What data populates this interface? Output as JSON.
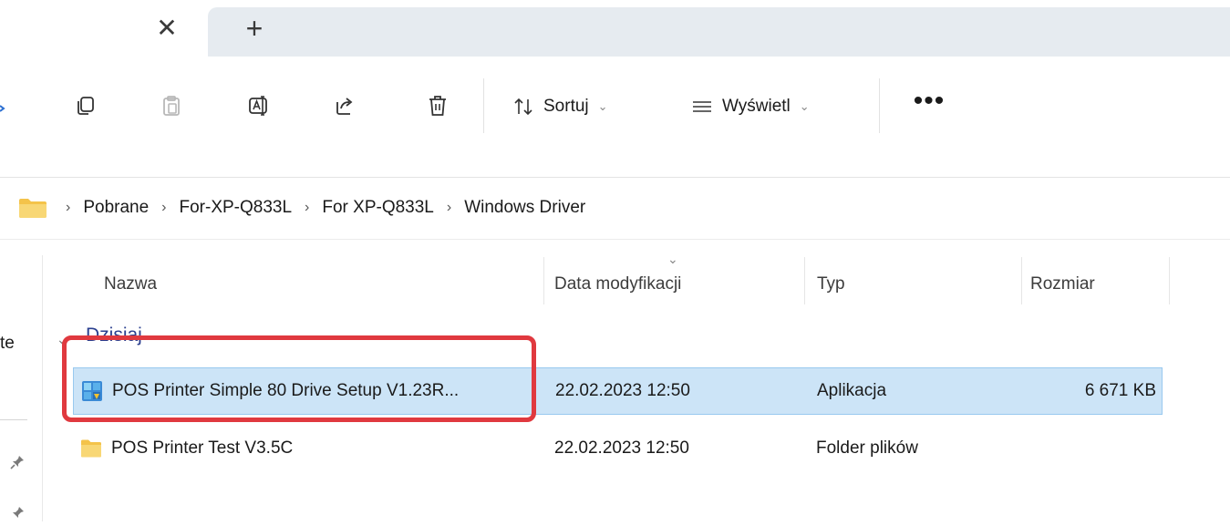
{
  "tabs": {
    "close_icon": "✕",
    "new_icon": "+"
  },
  "toolbar": {
    "sort_label": "Sortuj",
    "view_label": "Wyświetl",
    "more_label": "•••",
    "chevron": "⌄"
  },
  "breadcrumb": {
    "separator": "›",
    "items": [
      "Pobrane",
      "For-XP-Q833L",
      "For XP-Q833L",
      "Windows Driver"
    ]
  },
  "nav": {
    "partial_text": "te"
  },
  "columns": {
    "name": "Nazwa",
    "date": "Data modyfikacji",
    "type": "Typ",
    "size": "Rozmiar",
    "sort_indicator": "⌄"
  },
  "group": {
    "label": "Dzisiaj",
    "chevron": "⌄"
  },
  "files": [
    {
      "name": "POS Printer Simple 80 Drive Setup V1.23R...",
      "date": "22.02.2023 12:50",
      "type": "Aplikacja",
      "size": "6 671 KB",
      "icon": "installer-icon"
    },
    {
      "name": "POS Printer Test V3.5C",
      "date": "22.02.2023 12:50",
      "type": "Folder plików",
      "size": "",
      "icon": "folder-icon"
    }
  ],
  "colors": {
    "selection": "#cce4f7",
    "highlight_box": "#e0393f",
    "folder": "#f4c34a"
  }
}
